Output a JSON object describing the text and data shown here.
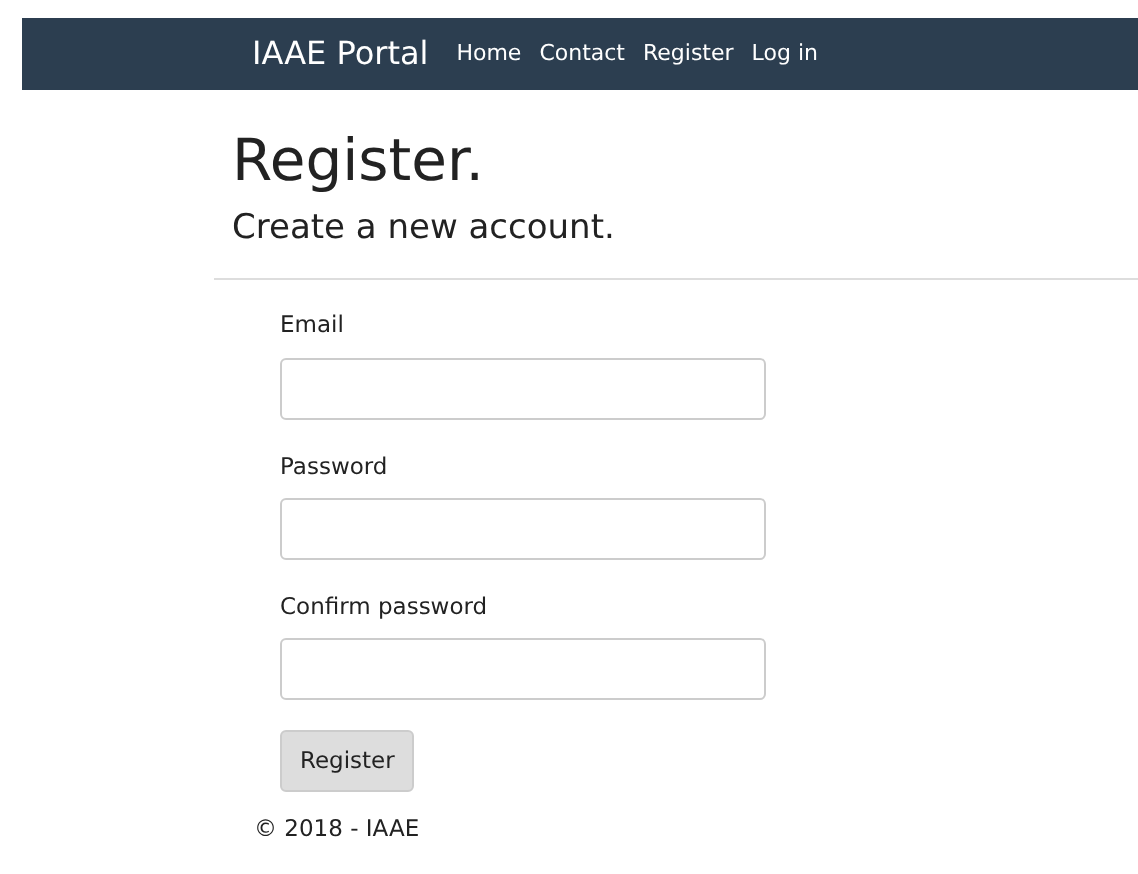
{
  "navbar": {
    "brand": "IAAE Portal",
    "links": [
      "Home",
      "Contact",
      "Register",
      "Log in"
    ]
  },
  "heading": "Register.",
  "subheading": "Create a new account.",
  "form": {
    "fields": [
      {
        "label": "Email"
      },
      {
        "label": "Password"
      },
      {
        "label": "Confirm password"
      }
    ],
    "submit": "Register"
  },
  "footer": "© 2018 - IAAE"
}
